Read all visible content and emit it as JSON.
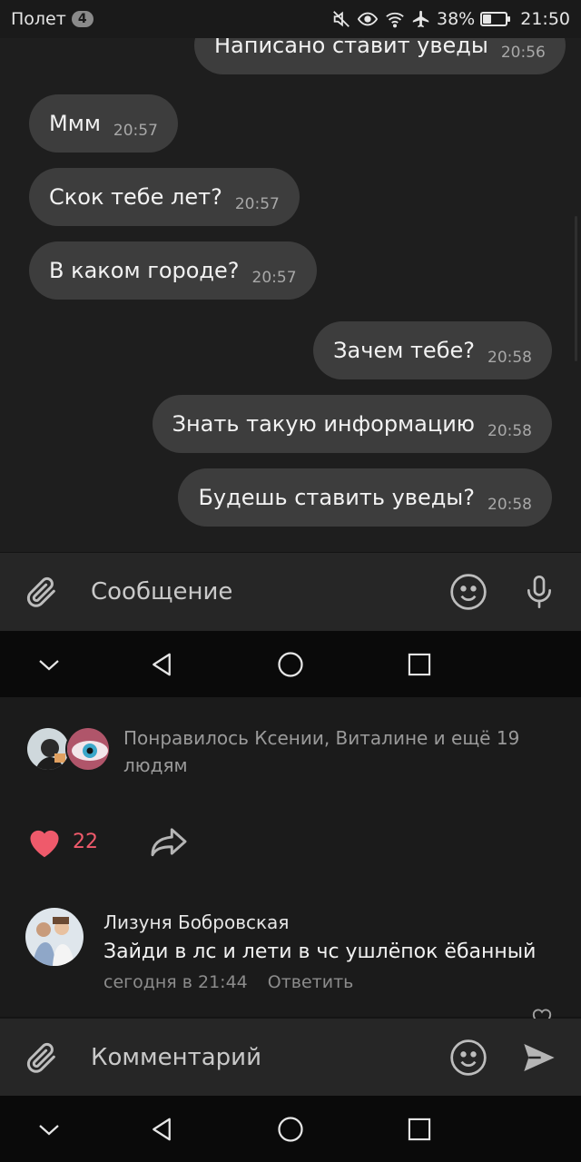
{
  "status_bar": {
    "carrier": "Полет",
    "notification_count": "4",
    "battery": "38%",
    "battery_fraction": 0.38,
    "time": "21:50"
  },
  "chat": {
    "messages": [
      {
        "text": "Написано ставит уведы",
        "time": "20:56",
        "side": "out"
      },
      {
        "text": "Ммм",
        "time": "20:57",
        "side": "in"
      },
      {
        "text": "Скок тебе лет?",
        "time": "20:57",
        "side": "in"
      },
      {
        "text": "В каком городе?",
        "time": "20:57",
        "side": "in"
      },
      {
        "text": "Зачем тебе?",
        "time": "20:58",
        "side": "out"
      },
      {
        "text": "Знать такую информацию",
        "time": "20:58",
        "side": "out"
      },
      {
        "text": "Будешь ставить уведы?",
        "time": "20:58",
        "side": "out"
      }
    ]
  },
  "message_composer": {
    "placeholder": "Сообщение"
  },
  "post": {
    "likes_text": "Понравилось Ксении, Виталине и ещё 19 людям",
    "like_count": "22",
    "comment": {
      "author": "Лизуня Бобровская",
      "text": "Зайди в лс и лети в чс ушлёпок ёбанный",
      "time": "сегодня в 21:44",
      "reply_label": "Ответить"
    }
  },
  "comment_composer": {
    "placeholder": "Комментарий"
  },
  "colors": {
    "bubble": "#3d3d3d",
    "like_red": "#ef5a6b",
    "background": "#1e1e1e"
  }
}
